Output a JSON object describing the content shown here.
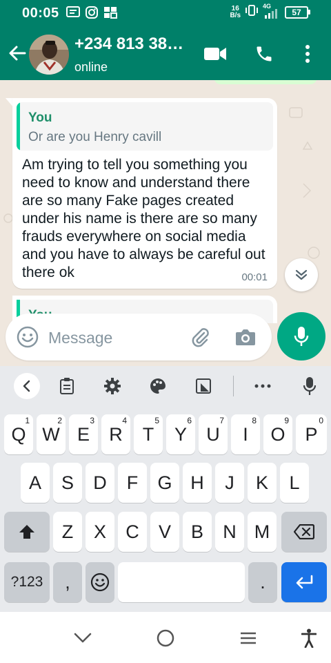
{
  "status_bar": {
    "time": "00:05",
    "net_speed_value": "16",
    "net_speed_unit": "B/s",
    "network_type": "4G",
    "battery": "57",
    "left_icons": [
      "message-icon",
      "instagram-icon",
      "gallery-icon"
    ],
    "right_icons": [
      "vibrate-icon",
      "signal-icon",
      "battery-icon"
    ]
  },
  "header": {
    "contact_name": "+234 813 38…",
    "contact_status": "online",
    "icons": [
      "back-arrow-icon",
      "video-call-icon",
      "phone-icon",
      "more-vert-icon"
    ]
  },
  "chat": {
    "message": {
      "quote_author": "You",
      "quote_text": "Or are you Henry cavill",
      "text": "Am trying to tell you something you need to know and understand there are so many Fake pages created under his name is there are so many frauds everywhere on social media and you have to always be careful out there ok",
      "time": "00:01"
    },
    "next_message_quote_author": "You"
  },
  "composer": {
    "placeholder": "Message",
    "icons": [
      "emoji-icon",
      "attach-icon",
      "camera-icon",
      "mic-icon"
    ]
  },
  "keyboard": {
    "toolbar_icons": [
      "chevron-left-icon",
      "clipboard-icon",
      "settings-icon",
      "palette-icon",
      "resize-icon",
      "more-horiz-icon",
      "mic-icon"
    ],
    "row1": [
      {
        "key": "Q",
        "hint": "1"
      },
      {
        "key": "W",
        "hint": "2"
      },
      {
        "key": "E",
        "hint": "3"
      },
      {
        "key": "R",
        "hint": "4"
      },
      {
        "key": "T",
        "hint": "5"
      },
      {
        "key": "Y",
        "hint": "6"
      },
      {
        "key": "U",
        "hint": "7"
      },
      {
        "key": "I",
        "hint": "8"
      },
      {
        "key": "O",
        "hint": "9"
      },
      {
        "key": "P",
        "hint": "0"
      }
    ],
    "row2": [
      "A",
      "S",
      "D",
      "F",
      "G",
      "H",
      "J",
      "K",
      "L"
    ],
    "row3": [
      "Z",
      "X",
      "C",
      "V",
      "B",
      "N",
      "M"
    ],
    "symbols_key": "?123",
    "comma_key": ",",
    "period_key": "."
  },
  "colors": {
    "header_green": "#008069",
    "chat_background": "#efe7de",
    "accent_green": "#00a884",
    "quote_author_green": "#1f8f6a",
    "enter_blue": "#1a73e8"
  },
  "nav_bar": {
    "icons": [
      "nav-down-icon",
      "nav-home-icon",
      "nav-recents-icon",
      "accessibility-icon"
    ]
  }
}
